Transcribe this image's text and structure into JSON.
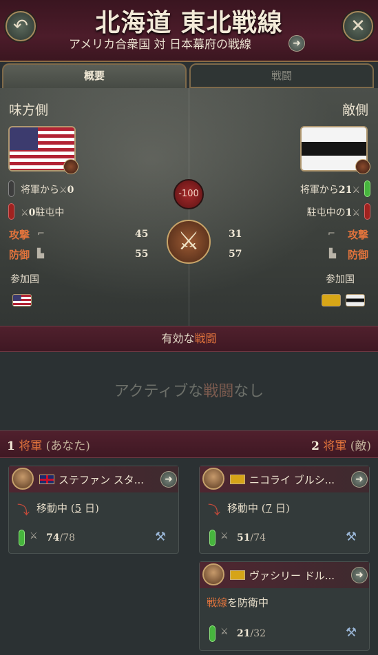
{
  "header": {
    "title": "北海道 東北戦線",
    "subtitle": "アメリカ合衆国 対 日本幕府の戦線",
    "back_icon": "back-arrow-icon",
    "close_icon": "close-icon",
    "go_icon": "arrow-right-icon"
  },
  "tabs": [
    {
      "label": "概要",
      "active": true
    },
    {
      "label": "戦闘",
      "active": false
    }
  ],
  "overview": {
    "left": {
      "label": "味方側",
      "generals_label": "将軍から",
      "generals_count": "0",
      "stationed_label": "駐屯中",
      "stationed_count": "0",
      "attack_label": "攻撃",
      "attack_value": "45",
      "defense_label": "防御",
      "defense_value": "55",
      "participants_label": "参加国"
    },
    "right": {
      "label": "敵側",
      "generals_label": "将軍から",
      "generals_count": "21",
      "stationed_label": "駐屯中の",
      "stationed_count": "1",
      "attack_label": "攻撃",
      "attack_value": "31",
      "defense_label": "防御",
      "defense_value": "57",
      "participants_label": "参加国"
    },
    "score": "-100"
  },
  "battles": {
    "title_prefix": "有効な",
    "title_accent": "戦闘",
    "empty_prefix": "アクティブな",
    "empty_accent": "戦闘",
    "empty_suffix": "なし"
  },
  "generals": {
    "left_count": "1",
    "left_label": "将軍",
    "left_suffix": "(あなた)",
    "right_count": "2",
    "right_label": "将軍",
    "right_suffix": "(敵)",
    "cards": [
      {
        "name": "ステファン スタ...",
        "status_prefix": "移動中 (",
        "status_days": "5",
        "status_suffix": " 日)",
        "current": "74",
        "max": "/78"
      },
      {
        "name": "ニコライ ブルシ...",
        "status_prefix": "移動中 (",
        "status_days": "7",
        "status_suffix": " 日)",
        "current": "51",
        "max": "/74"
      },
      {
        "name": "ヴァシリー ドル...",
        "status_accent": "戦線",
        "status_rest": "を防衛中",
        "current": "21",
        "max": "/32"
      }
    ]
  },
  "colors": {
    "accent": "#e0733c",
    "header_bg": "#4c1c2a",
    "banner_bg": "#50202d",
    "panel_bg": "#2b3133"
  }
}
